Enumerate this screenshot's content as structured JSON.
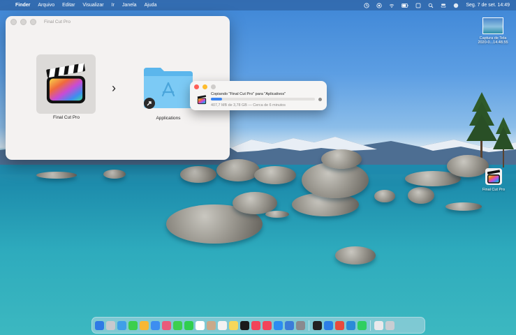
{
  "menubar": {
    "apple_glyph": "",
    "items": [
      "Finder",
      "Arquivo",
      "Editar",
      "Visualizar",
      "Ir",
      "Janela",
      "Ajuda"
    ],
    "datetime": "Seg. 7 de set.  14:49"
  },
  "finder_window": {
    "title": "Final Cut Pro",
    "app_label": "Final Cut Pro",
    "folder_label": "Applications"
  },
  "copy_dialog": {
    "message": "Copiando \"Final Cut Pro\" para \"Aplicativos\"",
    "status": "407,7 MB de 3,78 GB — Cerca de 6 minutos",
    "progress": 0.11
  },
  "desktop": {
    "screenshot_label": "Captura de Tela",
    "screenshot_sublabel": "2020-0...14.48.55",
    "fcp_label": "Final Cut Pro"
  },
  "dock": {
    "apps": [
      {
        "name": "finder",
        "color": "#2f7ae5"
      },
      {
        "name": "launchpad",
        "color": "#c7c9ce"
      },
      {
        "name": "safari",
        "color": "#3f9fe8"
      },
      {
        "name": "messages",
        "color": "#3ccf4e"
      },
      {
        "name": "mail",
        "color": "#f7b733"
      },
      {
        "name": "maps",
        "color": "#3d8ef0"
      },
      {
        "name": "photos",
        "color": "#e85b7a"
      },
      {
        "name": "facetime",
        "color": "#3ccf4e"
      },
      {
        "name": "phone",
        "color": "#2fcf4e"
      },
      {
        "name": "calendar",
        "color": "#ffffff"
      },
      {
        "name": "contacts",
        "color": "#c9a98a"
      },
      {
        "name": "reminders",
        "color": "#f2f2f2"
      },
      {
        "name": "notes",
        "color": "#f6d75a"
      },
      {
        "name": "tv",
        "color": "#1b1b1b"
      },
      {
        "name": "music",
        "color": "#f2445a"
      },
      {
        "name": "news",
        "color": "#f2445a"
      },
      {
        "name": "app-store",
        "color": "#2b8cf2"
      },
      {
        "name": "keynote",
        "color": "#3c7cd8"
      },
      {
        "name": "system-preferences",
        "color": "#8a8a8e"
      },
      {
        "name": "terminal",
        "color": "#222222"
      },
      {
        "name": "xcode",
        "color": "#2b7ee6"
      },
      {
        "name": "chrome",
        "color": "#e84a3c"
      },
      {
        "name": "vscode",
        "color": "#2a8bd8"
      },
      {
        "name": "whatsapp",
        "color": "#2fcf61"
      },
      {
        "name": "documents",
        "color": "#e9e9ec"
      },
      {
        "name": "trash",
        "color": "#c9cdd2"
      }
    ]
  }
}
